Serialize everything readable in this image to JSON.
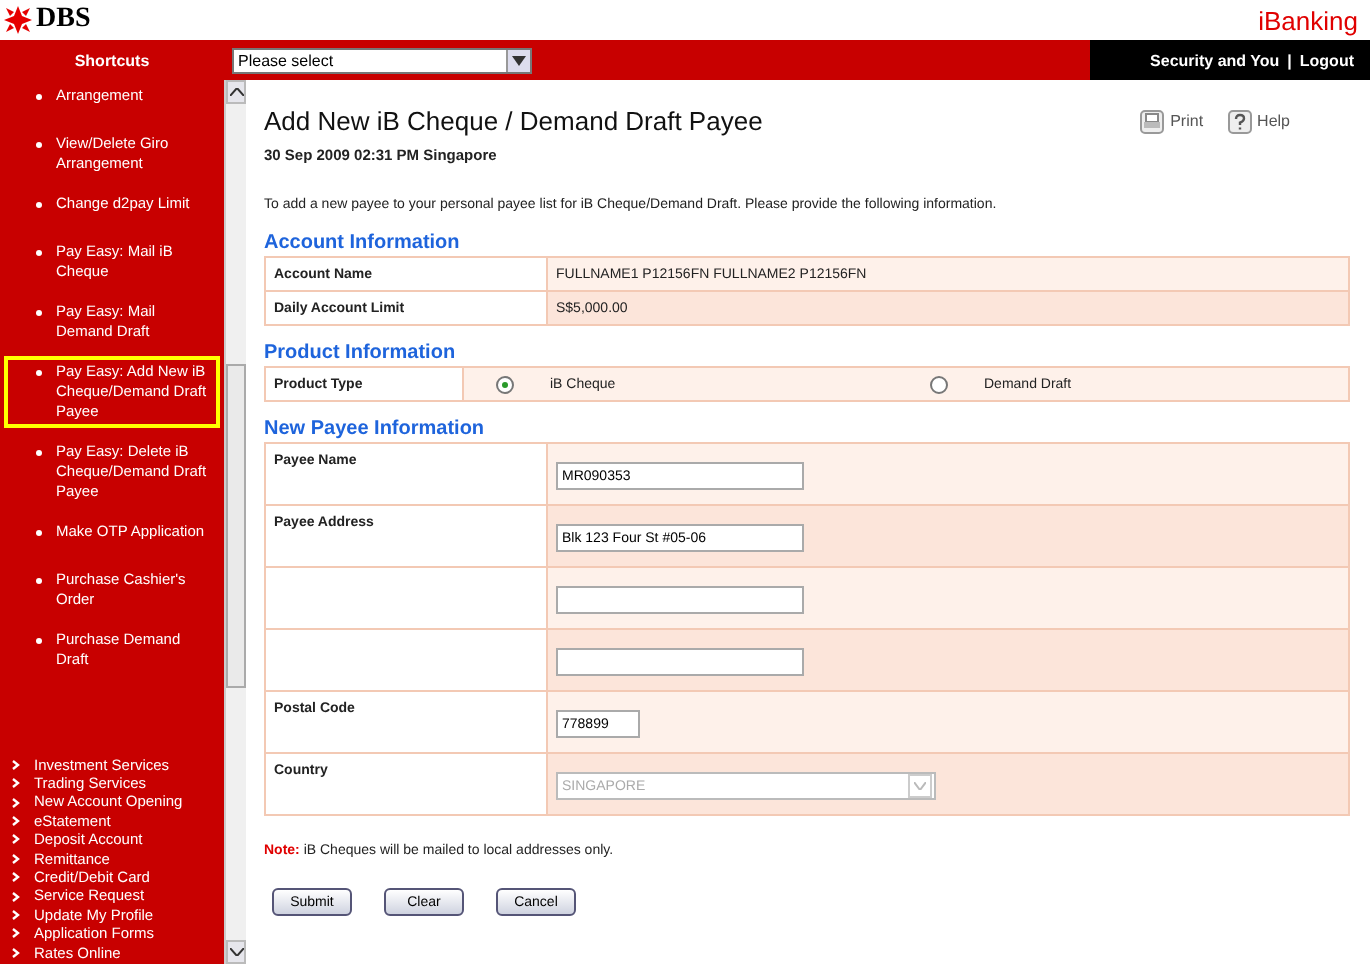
{
  "header": {
    "logo": "DBS",
    "product": "iBanking"
  },
  "topbar": {
    "shortcuts": "Shortcuts",
    "select_placeholder": "Please select",
    "links": [
      "Security and You",
      "Logout"
    ],
    "separator": "|"
  },
  "sidebar": {
    "items": [
      {
        "label": "Arrangement",
        "selected": false
      },
      {
        "label": "View/Delete Giro Arrangement",
        "selected": false
      },
      {
        "label": "Change d2pay Limit",
        "selected": false
      },
      {
        "label": "Pay Easy: Mail iB Cheque",
        "selected": false
      },
      {
        "label": "Pay Easy: Mail Demand Draft",
        "selected": false
      },
      {
        "label": "Pay Easy: Add New iB Cheque/Demand Draft Payee",
        "selected": true
      },
      {
        "label": "Pay Easy: Delete iB Cheque/Demand Draft Payee",
        "selected": false
      },
      {
        "label": "Make OTP Application",
        "selected": false
      },
      {
        "label": "Purchase Cashier's Order",
        "selected": false
      },
      {
        "label": "Purchase Demand Draft",
        "selected": false
      }
    ],
    "sections": [
      "Investment Services",
      "Trading Services",
      "New Account Opening",
      "eStatement",
      "Deposit Account",
      "Remittance",
      "Credit/Debit Card",
      "Service Request",
      "Update My Profile",
      "Application Forms",
      "Rates Online"
    ]
  },
  "page": {
    "title": "Add New iB Cheque / Demand Draft Payee",
    "datetime": "30 Sep 2009 02:31 PM  Singapore",
    "actions": [
      "Print",
      "Help"
    ],
    "intro": "To add a new payee to your personal payee list for iB Cheque/Demand Draft. Please provide the following information."
  },
  "account_info": {
    "heading": "Account Information",
    "rows": [
      {
        "label": "Account Name",
        "value": "FULLNAME1 P12156FN FULLNAME2 P12156FN"
      },
      {
        "label": "Daily Account Limit",
        "value": "S$5,000.00"
      }
    ]
  },
  "product_info": {
    "heading": "Product Information",
    "label": "Product Type",
    "options": [
      {
        "label": "iB Cheque",
        "selected": true
      },
      {
        "label": "Demand Draft",
        "selected": false
      }
    ]
  },
  "payee_info": {
    "heading": "New Payee Information",
    "rows": [
      {
        "label": "Payee Name",
        "kind": "text",
        "value": "MR090353"
      },
      {
        "label": "Payee Address",
        "kind": "text",
        "value": "Blk 123 Four St #05-06"
      },
      {
        "kind": "text"
      },
      {
        "kind": "text"
      },
      {
        "label": "Postal Code",
        "kind": "short",
        "value": "778899"
      },
      {
        "label": "Country",
        "kind": "select",
        "value": "SINGAPORE",
        "disabled": true
      }
    ]
  },
  "note": {
    "label": "Note:",
    "text": "iB Cheques will be mailed to local addresses only."
  },
  "buttons": [
    "Submit",
    "Clear",
    "Cancel"
  ]
}
